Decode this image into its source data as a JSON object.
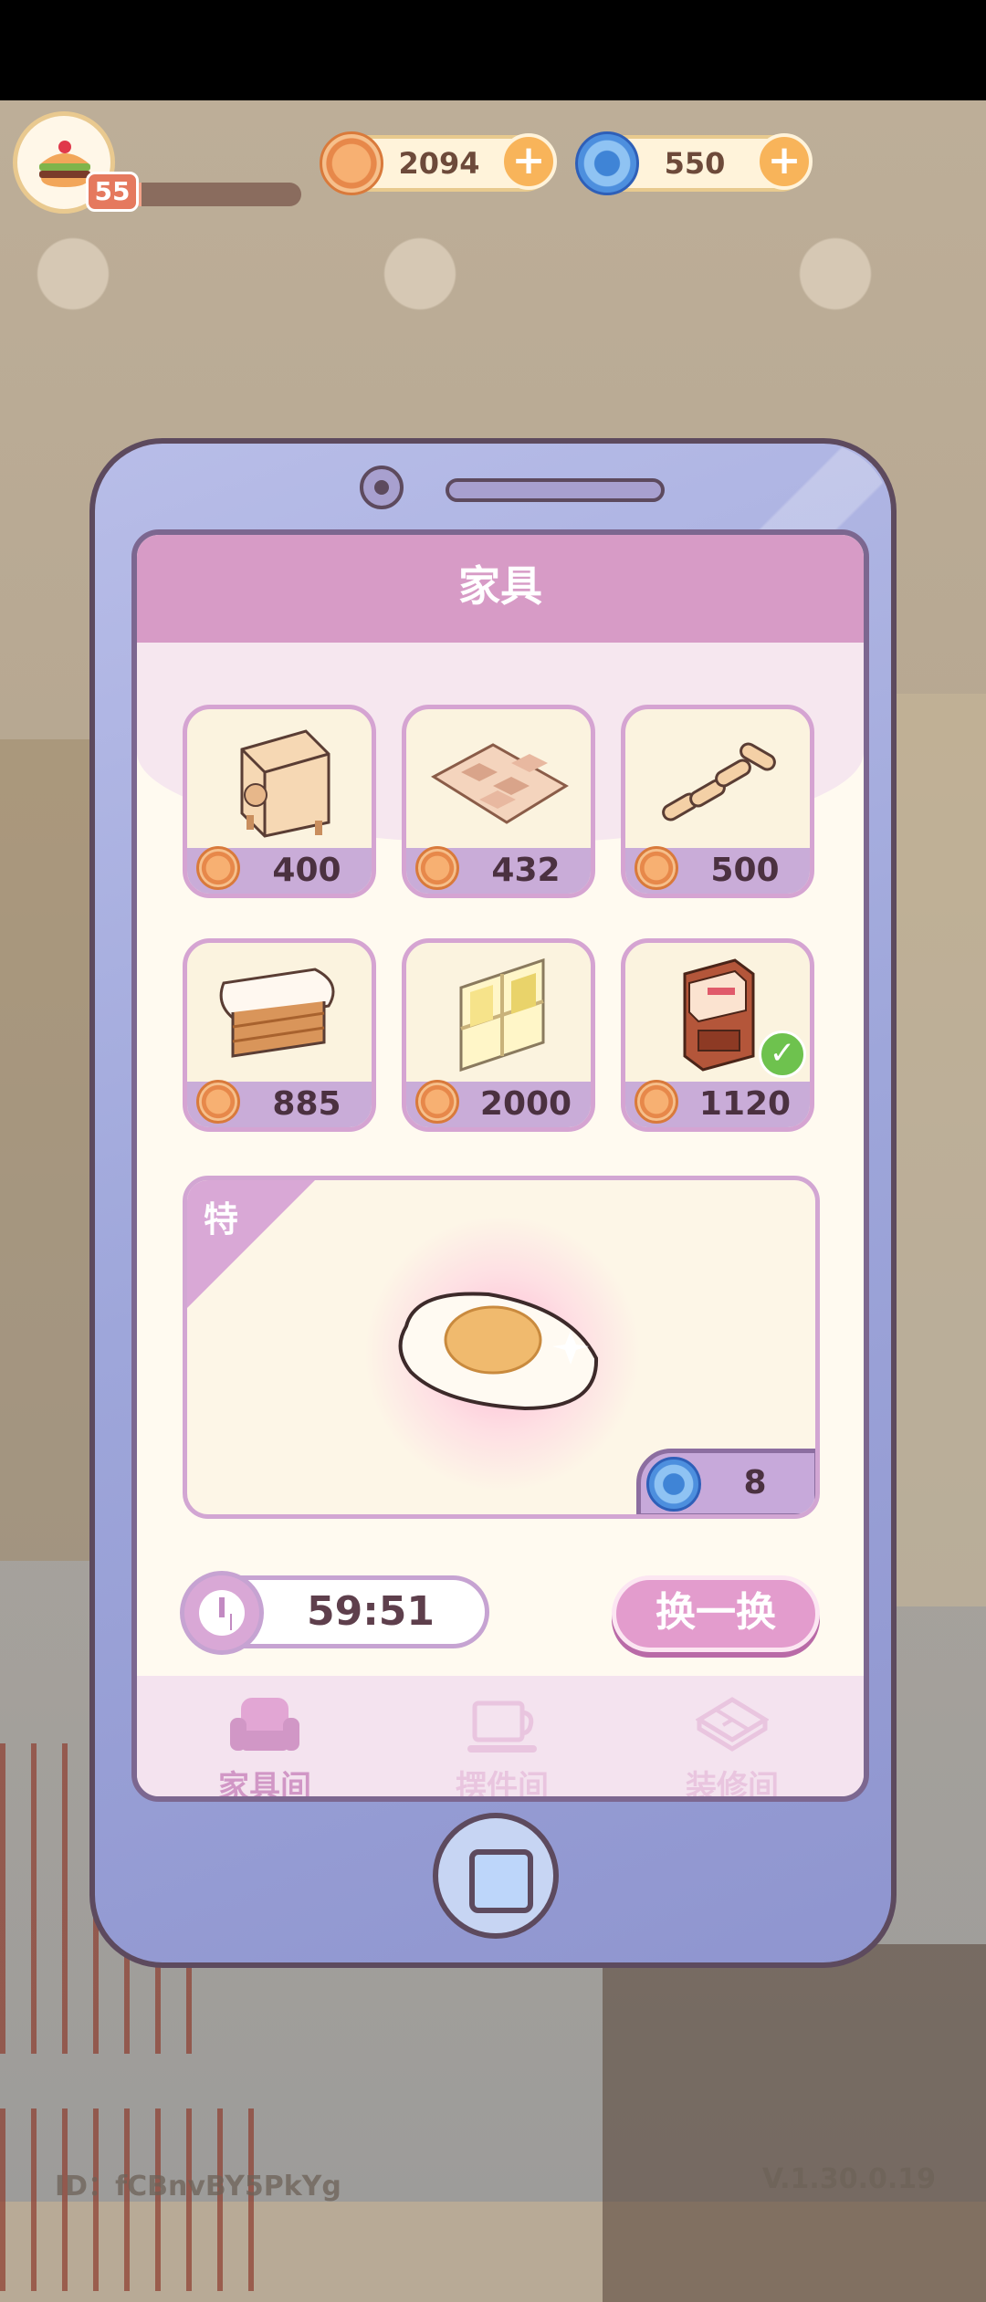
{
  "player": {
    "level": "55",
    "xp_progress": 0.08
  },
  "currencies": [
    {
      "name": "coins",
      "icon": "coin-icon",
      "value": "2094"
    },
    {
      "name": "gems",
      "icon": "swirl-gem-icon",
      "value": "550"
    }
  ],
  "shop": {
    "title": "家具",
    "items": [
      {
        "name": "cube-cat-bed",
        "price": "400",
        "owned": false
      },
      {
        "name": "patterned-rug",
        "price": "432",
        "owned": false
      },
      {
        "name": "wooden-planks",
        "price": "500",
        "owned": false
      },
      {
        "name": "glass-top-counter",
        "price": "885",
        "owned": false
      },
      {
        "name": "window-panel",
        "price": "2000",
        "owned": false
      },
      {
        "name": "wood-cabinet",
        "price": "1120",
        "owned": true
      }
    ],
    "special": {
      "tag": "特",
      "item": "fried-egg-rug",
      "price": "8",
      "price_icon": "swirl-gem-icon"
    },
    "timer": "59:51",
    "refresh_label": "换一换",
    "tabs": [
      {
        "label": "家具间",
        "icon": "armchair-icon",
        "active": true
      },
      {
        "label": "摆件间",
        "icon": "teacup-icon",
        "active": false
      },
      {
        "label": "装修间",
        "icon": "floor-tile-icon",
        "active": false
      }
    ]
  },
  "footer": {
    "id_label": "ID：fCBnvBY5PkYg",
    "version": "V.1.30.0.19"
  },
  "colors": {
    "accent": "#d79bc6",
    "phone": "#9ea6da",
    "price_bar": "#c9acd8",
    "owned": "#6ec24e"
  }
}
